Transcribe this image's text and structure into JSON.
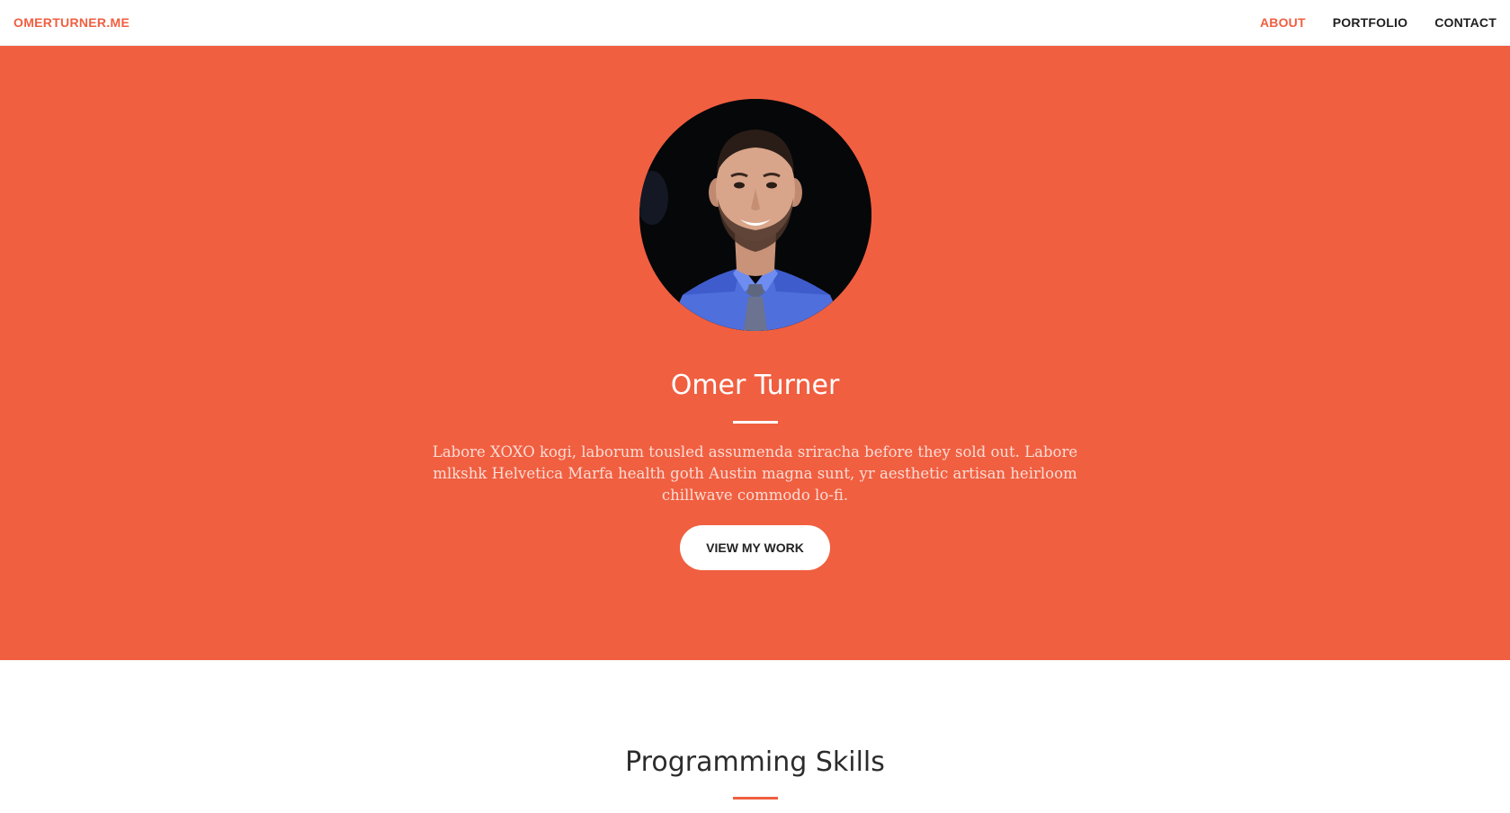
{
  "nav": {
    "brand": "OMERTURNER.ME",
    "links": [
      {
        "label": "ABOUT",
        "active": true
      },
      {
        "label": "PORTFOLIO",
        "active": false
      },
      {
        "label": "CONTACT",
        "active": false
      }
    ]
  },
  "hero": {
    "background": "#f05f40",
    "name": "Omer Turner",
    "description": "Labore XOXO kogi, laborum tousled assumenda sriracha before they sold out. Labore mlkshk Helvetica Marfa health goth Austin magna sunt, yr aesthetic artisan heirloom chillwave commodo lo-fi.",
    "cta_label": "VIEW MY WORK",
    "avatar_icon": "profile-photo"
  },
  "skills": {
    "title": "Programming Skills"
  },
  "colors": {
    "accent": "#f05f40",
    "text_dark": "#2c2c2c"
  }
}
